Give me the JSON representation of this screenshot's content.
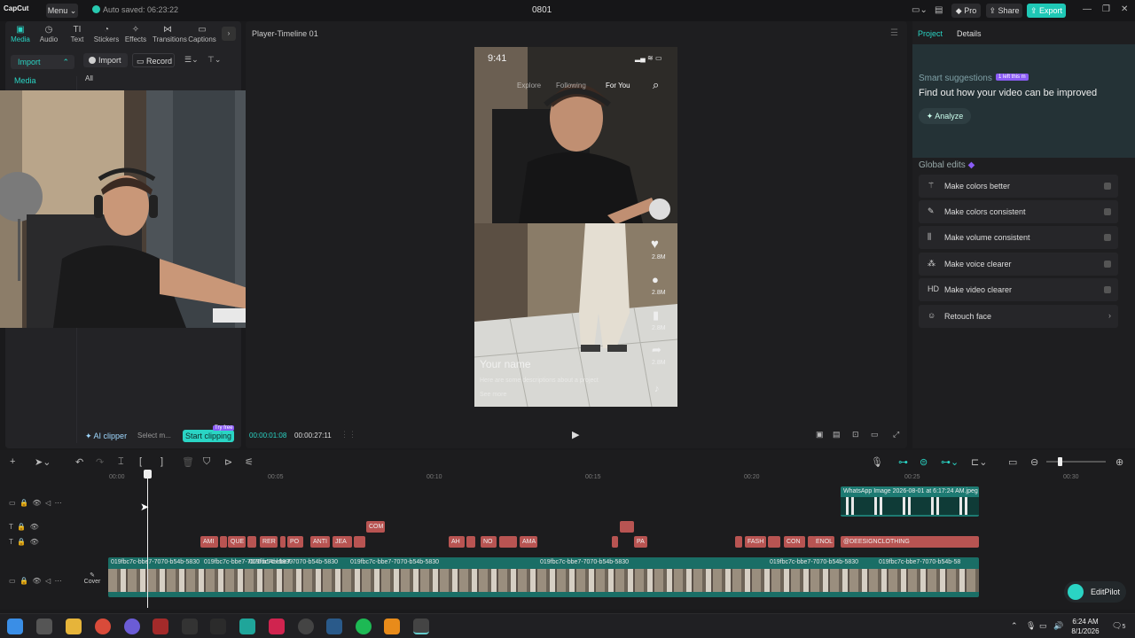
{
  "topbar": {
    "logo": "CapCut",
    "menu": "Menu",
    "autosave": "Auto saved: 06:23:22",
    "project_title": "0801",
    "pro": "Pro",
    "share": "Share",
    "export": "Export"
  },
  "left_panel": {
    "tabs": [
      {
        "icon": "media-icon",
        "label": "Media"
      },
      {
        "icon": "audio-icon",
        "label": "Audio"
      },
      {
        "icon": "text-icon",
        "label": "Text"
      },
      {
        "icon": "stickers-icon",
        "label": "Stickers"
      },
      {
        "icon": "effects-icon",
        "label": "Effects"
      },
      {
        "icon": "transitions-icon",
        "label": "Transitions"
      },
      {
        "icon": "captions-icon",
        "label": "Captions"
      }
    ],
    "side_import": "Import",
    "side_media": "Media",
    "import_btn": "Import",
    "record_btn": "Record",
    "all": "All",
    "ai_clipper": "AI clipper",
    "select_media": "Select m...",
    "start_clipping": "Start clipping",
    "try_free": "Try free"
  },
  "player": {
    "title": "Player-Timeline 01",
    "time_current": "00:00:01:08",
    "time_total": "00:00:27:11",
    "overlay": {
      "clock": "9:41",
      "explore": "Explore",
      "following": "Following",
      "for_you": "For You",
      "likes": "2.8M",
      "comments": "2.8M",
      "saves": "2.8M",
      "shares": "2.8M",
      "your_name": "Your name",
      "caption": "Here are some descriptions about a project",
      "see_more": "See more"
    }
  },
  "right_panel": {
    "tab_project": "Project",
    "tab_details": "Details",
    "smart_suggestions": "Smart suggestions",
    "smart_badge": "1 left this m",
    "find_out": "Find out how your video can be improved",
    "analyze": "Analyze",
    "global_edits": "Global edits",
    "edits": [
      {
        "icon": "wand-icon",
        "label": "Make colors better"
      },
      {
        "icon": "palette-icon",
        "label": "Make colors consistent"
      },
      {
        "icon": "volume-icon",
        "label": "Make volume consistent"
      },
      {
        "icon": "voice-icon",
        "label": "Make voice clearer"
      },
      {
        "icon": "hd-icon",
        "label": "Make video clearer"
      },
      {
        "icon": "face-icon",
        "label": "Retouch face"
      }
    ]
  },
  "timeline": {
    "ruler": [
      "00:00",
      "00:05",
      "00:10",
      "00:15",
      "00:20",
      "00:25",
      "00:30"
    ],
    "whatsapp_clip": "WhatsApp Image 2026-08-01 at 6:17:24 AM.jpeg",
    "com_clip": "COM",
    "text_clips": [
      "AMI",
      "QUE",
      "RER",
      "PO",
      "ANTI",
      "JEA",
      "AH",
      "NO",
      "AMA",
      "PA",
      "FASH",
      "CON",
      "ENOL",
      "@DEESIGNCLOTHING"
    ],
    "main_clip_label": "019fbc7c-bbe7-7070-b54b-5830",
    "main_clip_short": "019fbc7c-bbe7-7070-b54b-58",
    "cover": "Cover",
    "editpilot": "EditPilot"
  },
  "taskbar": {
    "time": "6:24 AM",
    "date": "8/1/2026",
    "notif_count": "5"
  }
}
